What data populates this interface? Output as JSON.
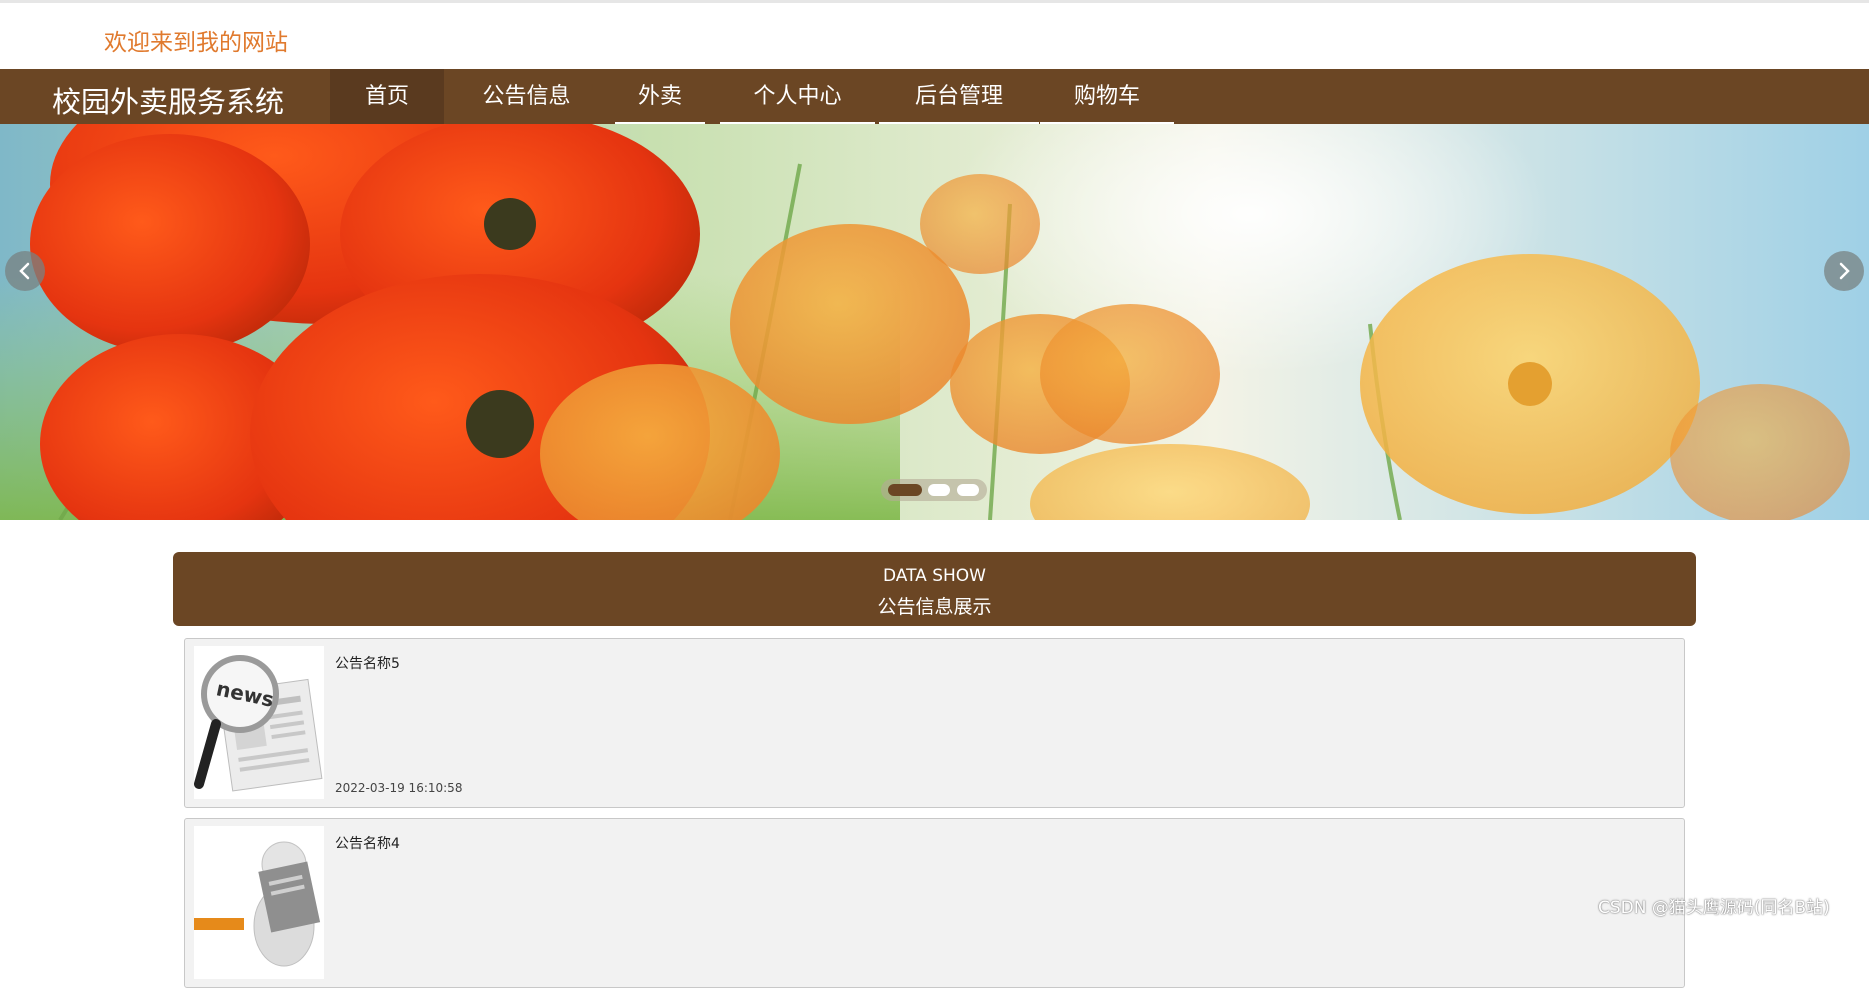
{
  "header": {
    "welcome_text": "欢迎来到我的网站"
  },
  "nav": {
    "site_title": "校园外卖服务系统",
    "items": [
      {
        "label": "首页"
      },
      {
        "label": "公告信息"
      },
      {
        "label": "外卖"
      },
      {
        "label": "个人中心"
      },
      {
        "label": "后台管理"
      },
      {
        "label": "购物车"
      }
    ],
    "active_index": 0
  },
  "banner": {
    "image": "poppy-flowers-banner",
    "prev_icon": "chevron-left-icon",
    "next_icon": "chevron-right-icon",
    "slide_count": 3,
    "active_slide": 0
  },
  "section": {
    "title_en": "DATA SHOW",
    "title_cn": "公告信息展示"
  },
  "notices": [
    {
      "title": "公告名称5",
      "date": "2022-03-19 16:10:58",
      "thumbnail": "news-magnifier-icon"
    },
    {
      "title": "公告名称4",
      "date": "",
      "thumbnail": "person-reading-newspaper-icon"
    }
  ],
  "watermark": "CSDN @猫头鹰源码(同名B站)",
  "colors": {
    "brand_brown": "#6b4624",
    "active_nav": "#5a3a1f",
    "welcome_orange": "#e07a2e",
    "card_bg": "#f2f2f2"
  }
}
